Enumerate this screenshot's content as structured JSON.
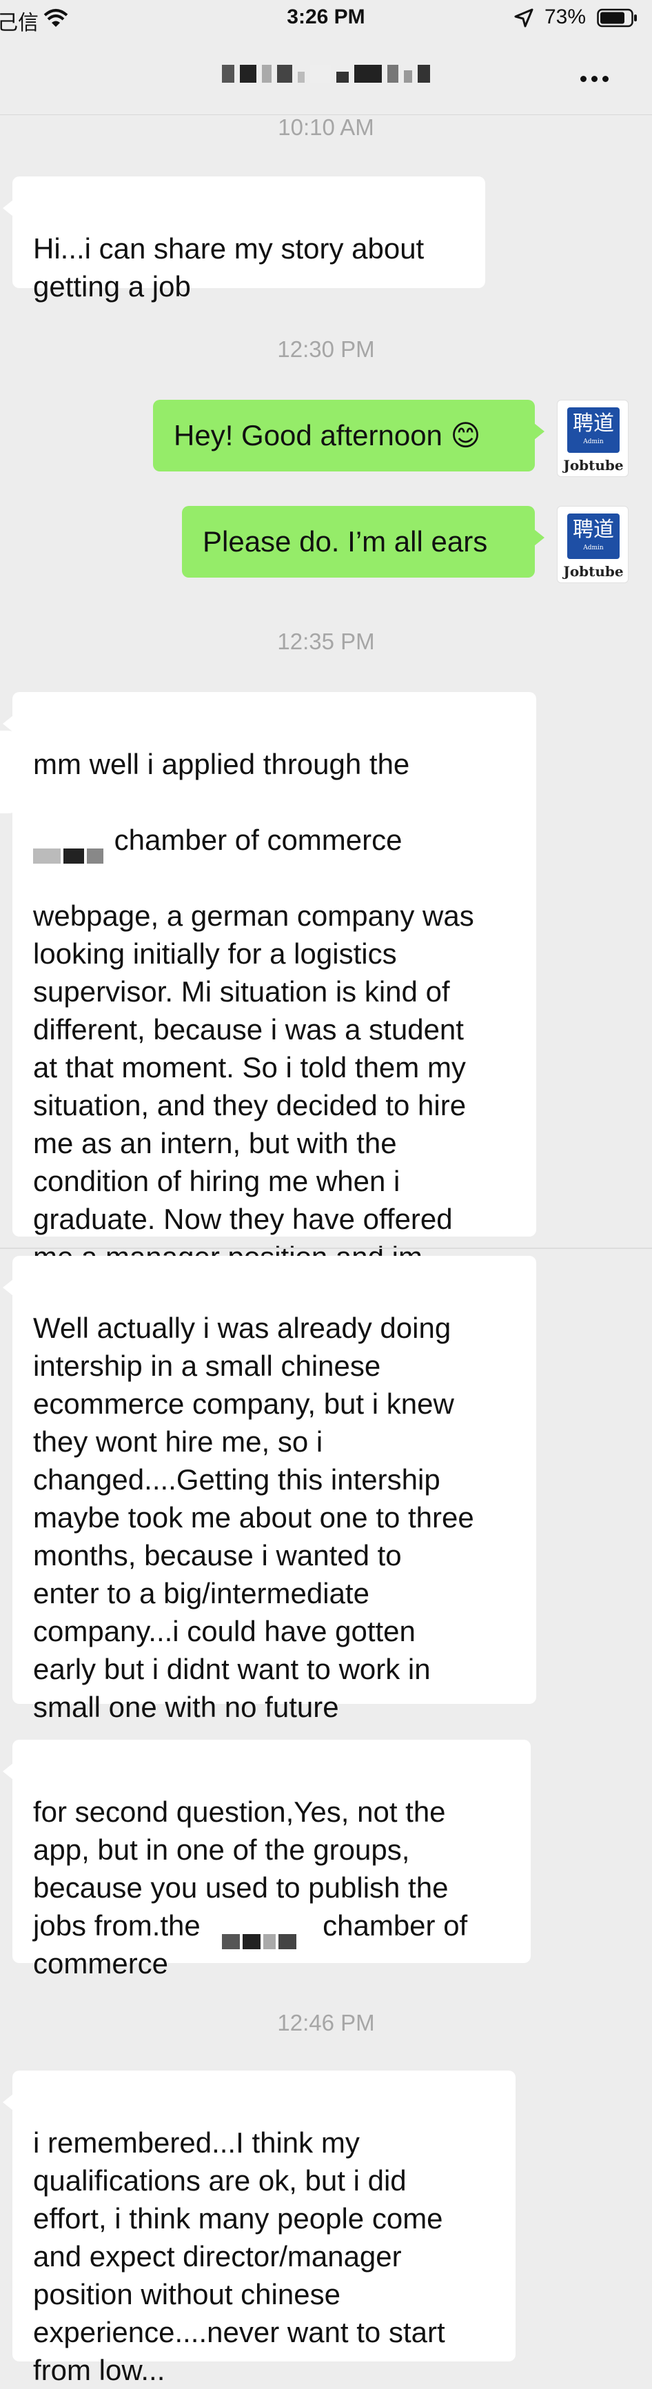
{
  "status_bar": {
    "carrier": "己信",
    "time": "3:26 PM",
    "battery_percent": "73%"
  },
  "chat": {
    "more_icon": "more-horizontal-icon",
    "messages": [
      {
        "type": "time",
        "text": "10:10 AM"
      },
      {
        "type": "incoming",
        "text": "Hi...i can share my story about\ngetting a job"
      },
      {
        "type": "time",
        "text": "12:30 PM"
      },
      {
        "type": "outgoing",
        "text": "Hey! Good afternoon 😊"
      },
      {
        "type": "outgoing",
        "text": "Please do. I’m all ears"
      },
      {
        "type": "time",
        "text": "12:35 PM"
      },
      {
        "type": "incoming",
        "line1": "mm well i applied through the",
        "line2_suffix": " chamber of commerce",
        "line3_prefix": "w",
        "rest": "ebpage, a german company was\nlooking initially for a logistics\nsupervisor. Mi situation is kind of\ndifferent, because i was a student\nat that moment.  So i told them my\nsituation, and they decided to hire\nme as an intern, but with the\ncondition of hiring me when i\ngraduate. Now they have offered\nme a manager position and im\nprocess of getting my work visa."
      },
      {
        "type": "incoming",
        "text": "Well actually i was already doing\nintership in a small chinese\necommerce company, but i knew\nthey wont hire me, so i\nchanged....Getting this intership\nmaybe took me about one to three\nmonths, because i wanted to\nenter to a big/intermediate\ncompany...i could have gotten\nearly but i didnt want to work in\nsmall one with no future"
      },
      {
        "type": "incoming",
        "text_a": "for second question,Yes, not the\napp, but in one of the groups,\nbecause you used to publish the\njobs from.the ",
        "text_b": " chamber of\ncommerce"
      },
      {
        "type": "time",
        "text": "12:46 PM"
      },
      {
        "type": "incoming",
        "text": "i remembered...I think my\nqualifications are ok, but i did\neffort, i think many people come\nand expect director/manager\nposition without chinese\nexperience....never want to start\nfrom low..."
      }
    ]
  },
  "avatar": {
    "logo_chars": "聘道",
    "logo_sub": "Admin",
    "logo_name": "Jobtube"
  },
  "colors": {
    "outgoing_bubble": "#95ec69",
    "incoming_bubble": "#ffffff",
    "background": "#ededed",
    "avatar_blue": "#1e4fa5"
  }
}
